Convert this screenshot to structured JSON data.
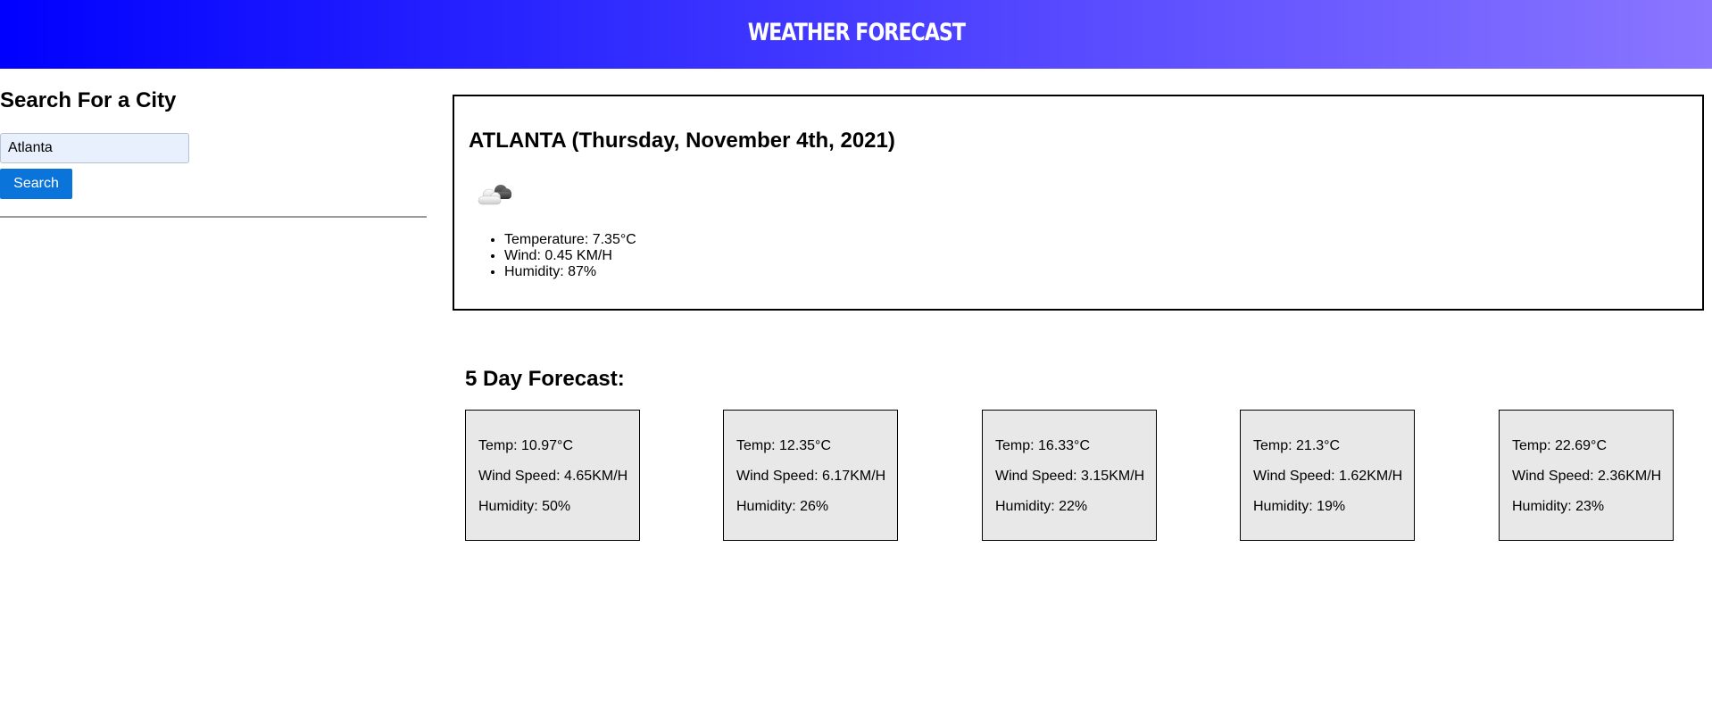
{
  "header": {
    "title": "Weather Forecast"
  },
  "sidebar": {
    "title": "Search For a City",
    "search_value": "Atlanta",
    "search_button_label": "Search"
  },
  "current": {
    "title": "ATLANTA (Thursday, November 4th, 2021)",
    "icon": "cloud-icon",
    "temperature": "Temperature: 7.35°C",
    "wind": "Wind: 0.45 KM/H",
    "humidity": "Humidity: 87%"
  },
  "forecast": {
    "title": "5 Day Forecast:",
    "days": [
      {
        "temp": "Temp: 10.97°C",
        "wind": "Wind Speed: 4.65KM/H",
        "humidity": "Humidity: 50%"
      },
      {
        "temp": "Temp: 12.35°C",
        "wind": "Wind Speed: 6.17KM/H",
        "humidity": "Humidity: 26%"
      },
      {
        "temp": "Temp: 16.33°C",
        "wind": "Wind Speed: 3.15KM/H",
        "humidity": "Humidity: 22%"
      },
      {
        "temp": "Temp: 21.3°C",
        "wind": "Wind Speed: 1.62KM/H",
        "humidity": "Humidity: 19%"
      },
      {
        "temp": "Temp: 22.69°C",
        "wind": "Wind Speed: 2.36KM/H",
        "humidity": "Humidity: 23%"
      }
    ]
  },
  "colors": {
    "header_gradient_start": "#0000ff",
    "header_gradient_end": "#8a76ff",
    "search_button": "#0a74da",
    "input_background": "#e8f0fe",
    "forecast_card_background": "#e8e8e8"
  }
}
